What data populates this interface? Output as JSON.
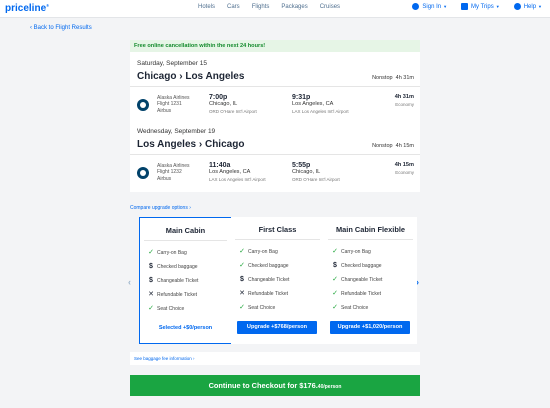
{
  "header": {
    "logo": "priceline",
    "logo_mark": "®",
    "nav": [
      "Hotels",
      "Cars",
      "Flights",
      "Packages",
      "Cruises"
    ],
    "sign_in": "Sign In",
    "my_trips": "My Trips",
    "help": "Help"
  },
  "back_link": "‹ Back to Flight Results",
  "banner": "Free online cancellation within the next 24 hours!",
  "segments": [
    {
      "date": "Saturday, September 15",
      "route": "Chicago › Los Angeles",
      "stops": "Nonstop",
      "duration": "4h 31m",
      "airline": "Alaska Airlines",
      "flight": "Flight 1231",
      "aircraft": "Airbus",
      "depart_time": "7:00p",
      "depart_city": "Chicago, IL",
      "depart_airport": "ORD O'Hare Int'l Airport",
      "arrive_time": "9:31p",
      "arrive_city": "Los Angeles, CA",
      "arrive_airport": "LAX Los Angeles Int'l Airport",
      "flight_duration": "4h 31m",
      "cabin": "Economy"
    },
    {
      "date": "Wednesday, September 19",
      "route": "Los Angeles › Chicago",
      "stops": "Nonstop",
      "duration": "4h 15m",
      "airline": "Alaska Airlines",
      "flight": "Flight 1232",
      "aircraft": "Airbus",
      "depart_time": "11:40a",
      "depart_city": "Los Angeles, CA",
      "depart_airport": "LAX Los Angeles Int'l Airport",
      "arrive_time": "5:55p",
      "arrive_city": "Chicago, IL",
      "arrive_airport": "ORD O'Hare Int'l Airport",
      "flight_duration": "4h 15m",
      "cabin": "Economy"
    }
  ],
  "compare_link": "Compare upgrade options ›",
  "fares": [
    {
      "title": "Main Cabin",
      "selected": true,
      "action": "Selected +$0/person",
      "features": [
        {
          "icon": "check-icon",
          "label": "Carry-on Bag"
        },
        {
          "icon": "dollar-icon",
          "label": "Checked baggage"
        },
        {
          "icon": "dollar-icon",
          "label": "Changeable Ticket"
        },
        {
          "icon": "x-icon",
          "label": "Refundable Ticket"
        },
        {
          "icon": "check-icon",
          "label": "Seat Choice"
        }
      ]
    },
    {
      "title": "First Class",
      "selected": false,
      "action": "Upgrade +$768/person",
      "features": [
        {
          "icon": "check-icon",
          "label": "Carry-on Bag"
        },
        {
          "icon": "check-icon",
          "label": "Checked baggage"
        },
        {
          "icon": "dollar-icon",
          "label": "Changeable Ticket"
        },
        {
          "icon": "x-icon",
          "label": "Refundable Ticket"
        },
        {
          "icon": "check-icon",
          "label": "Seat Choice"
        }
      ]
    },
    {
      "title": "Main Cabin Flexible",
      "selected": false,
      "action": "Upgrade +$1,020/person",
      "features": [
        {
          "icon": "check-icon",
          "label": "Carry-on Bag"
        },
        {
          "icon": "dollar-icon",
          "label": "Checked baggage"
        },
        {
          "icon": "check-icon",
          "label": "Changeable Ticket"
        },
        {
          "icon": "check-icon",
          "label": "Refundable Ticket"
        },
        {
          "icon": "check-icon",
          "label": "Seat Choice"
        }
      ]
    }
  ],
  "baggage_link": "See baggage fee information ›",
  "checkout": {
    "label": "Continue to Checkout for $176.",
    "cents": "40",
    "suffix": "/person"
  },
  "colors": {
    "accent": "#0068ef",
    "banner_green": "#128a2b",
    "checkout_green": "#1aa542"
  }
}
